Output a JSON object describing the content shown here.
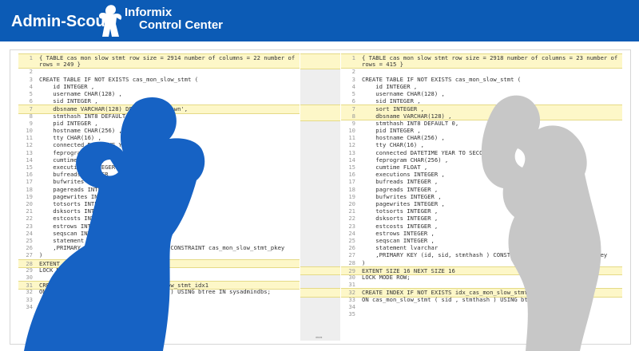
{
  "banner": {
    "brand": "Admin-Scout",
    "product_line1": "Informix",
    "product_line2": "Control Center",
    "logo_icon": "person-silhouette-icon",
    "background": "#0c5bb5"
  },
  "left_pane": {
    "lines": [
      {
        "n": "1",
        "t": "{ TABLE cas_mon_slow_stmt row size = 2914 number of columns = 22 number of",
        "hl": true
      },
      {
        "n": "",
        "t": "rows = 249 }",
        "hl": true
      },
      {
        "n": "2",
        "t": ""
      },
      {
        "n": "3",
        "t": "CREATE TABLE IF NOT EXISTS cas_mon_slow_stmt ("
      },
      {
        "n": "4",
        "t": "    id INTEGER ,"
      },
      {
        "n": "5",
        "t": "    username CHAR(128) ,"
      },
      {
        "n": "6",
        "t": "    sid INTEGER ,"
      },
      {
        "n": "7",
        "t": "    dbsname VARCHAR(128) DEFAULT 'unknown',",
        "hl": true
      },
      {
        "n": "8",
        "t": "    stmthash INT8 DEFAULT 0,"
      },
      {
        "n": "9",
        "t": "    pid INTEGER ,"
      },
      {
        "n": "10",
        "t": "    hostname CHAR(256) ,"
      },
      {
        "n": "11",
        "t": "    tty CHAR(16) ,"
      },
      {
        "n": "12",
        "t": "    connected DATETIME YEAR TO SECOND ,"
      },
      {
        "n": "13",
        "t": "    feprogram CHAR(256) ,"
      },
      {
        "n": "14",
        "t": "    cumtime FLOAT ,"
      },
      {
        "n": "15",
        "t": "    executions INTEGER ,"
      },
      {
        "n": "16",
        "t": "    bufreads INTEGER ,"
      },
      {
        "n": "17",
        "t": "    bufwrites INTEGER ,"
      },
      {
        "n": "18",
        "t": "    pagereads INTEGER ,"
      },
      {
        "n": "19",
        "t": "    pagewrites INTEGER ,"
      },
      {
        "n": "20",
        "t": "    totsorts INTEGER ,"
      },
      {
        "n": "21",
        "t": "    dsksorts INTEGER ,"
      },
      {
        "n": "22",
        "t": "    estcosts INTEGER ,"
      },
      {
        "n": "23",
        "t": "    estrows INTEGER ,"
      },
      {
        "n": "24",
        "t": "    seqscan INTEGER ,"
      },
      {
        "n": "25",
        "t": "    statement lvarchar"
      },
      {
        "n": "26",
        "t": "    ,PRIMARY KEY (id, sid, stmthash ) CONSTRAINT cas_mon_slow_stmt_pkey"
      },
      {
        "n": "27",
        "t": ")"
      },
      {
        "n": "28",
        "t": "EXTENT SIZE 128 NEXT SIZE 64",
        "hl": true
      },
      {
        "n": "29",
        "t": "LOCK MODE ROW;"
      },
      {
        "n": "30",
        "t": ""
      },
      {
        "n": "31",
        "t": "CREATE INDEX IF NOT EXISTS cas_mon_slow_stmt_idx1",
        "hl": true
      },
      {
        "n": "32",
        "t": "ON cas_mon_slow_stmt ( sid , stmthash ) USING btree IN sysadmindbs;"
      },
      {
        "n": "33",
        "t": ""
      },
      {
        "n": "34",
        "t": ""
      }
    ]
  },
  "right_pane": {
    "lines": [
      {
        "n": "1",
        "t": "{ TABLE cas_mon_slow_stmt row size = 2918 number of columns = 23 number of",
        "hl": true
      },
      {
        "n": "",
        "t": "rows = 415 }",
        "hl": true
      },
      {
        "n": "2",
        "t": ""
      },
      {
        "n": "3",
        "t": "CREATE TABLE IF NOT EXISTS cas_mon_slow_stmt ("
      },
      {
        "n": "4",
        "t": "    id INTEGER ,"
      },
      {
        "n": "5",
        "t": "    username CHAR(128) ,"
      },
      {
        "n": "6",
        "t": "    sid INTEGER ,"
      },
      {
        "n": "7",
        "t": "    sort INTEGER ,",
        "hl": true
      },
      {
        "n": "8",
        "t": "    dbsname VARCHAR(128) ,",
        "hl": true
      },
      {
        "n": "9",
        "t": "    stmthash INT8 DEFAULT 0,"
      },
      {
        "n": "10",
        "t": "    pid INTEGER ,"
      },
      {
        "n": "11",
        "t": "    hostname CHAR(256) ,"
      },
      {
        "n": "12",
        "t": "    tty CHAR(16) ,"
      },
      {
        "n": "13",
        "t": "    connected DATETIME YEAR TO SECOND ,"
      },
      {
        "n": "14",
        "t": "    feprogram CHAR(256) ,"
      },
      {
        "n": "15",
        "t": "    cumtime FLOAT ,"
      },
      {
        "n": "16",
        "t": "    executions INTEGER ,"
      },
      {
        "n": "17",
        "t": "    bufreads INTEGER ,"
      },
      {
        "n": "18",
        "t": "    pagreads INTEGER ,"
      },
      {
        "n": "19",
        "t": "    bufwrites INTEGER ,"
      },
      {
        "n": "20",
        "t": "    pagewrites INTEGER ,"
      },
      {
        "n": "21",
        "t": "    totsorts INTEGER ,"
      },
      {
        "n": "22",
        "t": "    dsksorts INTEGER ,"
      },
      {
        "n": "23",
        "t": "    estcosts INTEGER ,"
      },
      {
        "n": "24",
        "t": "    estrows INTEGER ,"
      },
      {
        "n": "25",
        "t": "    seqscan INTEGER ,"
      },
      {
        "n": "26",
        "t": "    statement lvarchar"
      },
      {
        "n": "27",
        "t": "    ,PRIMARY KEY (id, sid, stmthash ) CONSTRAINT cas_mon_slow_stmt_pkey"
      },
      {
        "n": "28",
        "t": ")"
      },
      {
        "n": "29",
        "t": "EXTENT SIZE 16 NEXT SIZE 16",
        "hl": true
      },
      {
        "n": "30",
        "t": "LOCK MODE ROW;"
      },
      {
        "n": "31",
        "t": ""
      },
      {
        "n": "32",
        "t": "CREATE INDEX IF NOT EXISTS idx_cas_mon_slow_stmt",
        "hl": true
      },
      {
        "n": "33",
        "t": "ON cas_mon_slow_stmt ( sid , stmthash ) USING btree IN sysadmindbs;"
      },
      {
        "n": "34",
        "t": ""
      },
      {
        "n": "35",
        "t": ""
      }
    ]
  },
  "colors": {
    "diff_highlight": "#fdf7c8",
    "keyword": "#8b2d93",
    "string": "#b21a1a",
    "mascot_blue": "#1662c4",
    "mascot_gray": "#c7c7c7"
  },
  "gutter_icon": "merge-arrows-icon"
}
